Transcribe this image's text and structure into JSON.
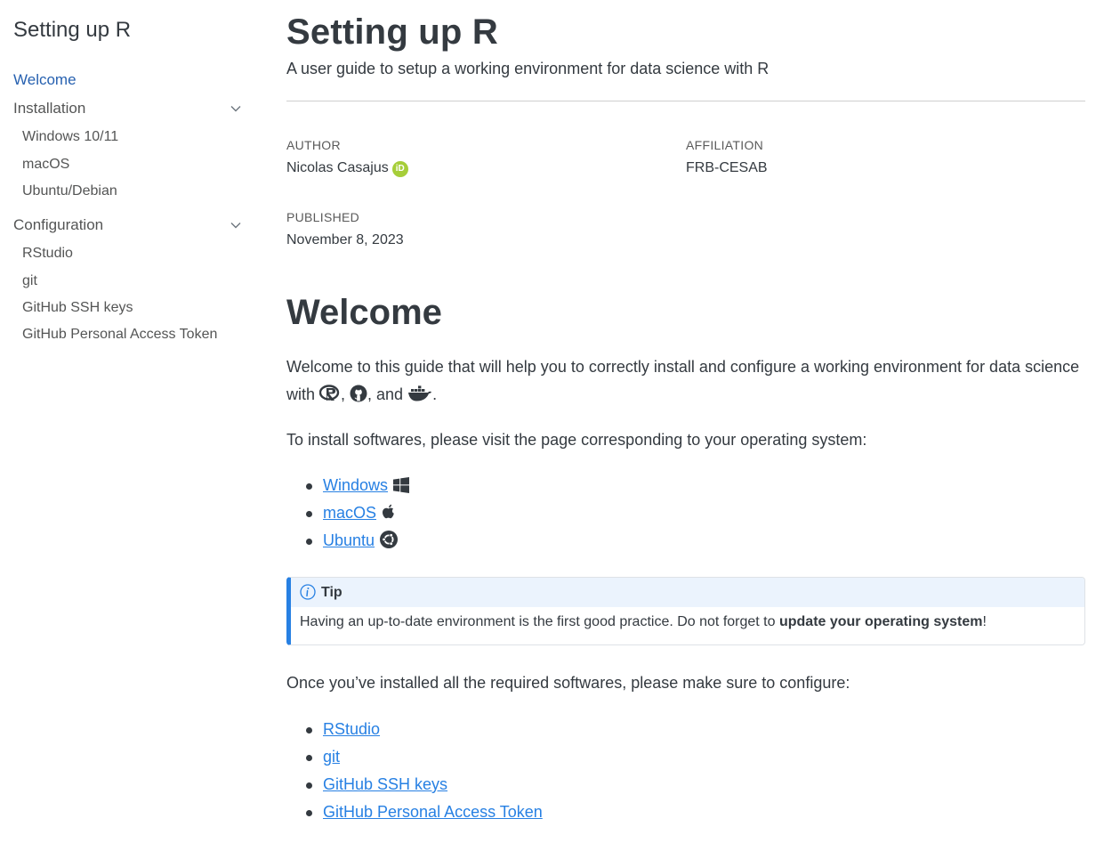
{
  "sidebar": {
    "title": "Setting up R",
    "welcome": "Welcome",
    "installation": {
      "label": "Installation",
      "items": [
        "Windows 10/11",
        "macOS",
        "Ubuntu/Debian"
      ]
    },
    "configuration": {
      "label": "Configuration",
      "items": [
        "RStudio",
        "git",
        "GitHub SSH keys",
        "GitHub Personal Access Token"
      ]
    }
  },
  "main": {
    "title": "Setting up R",
    "subtitle": "A user guide to setup a working environment for data science with R",
    "meta": {
      "author_label": "AUTHOR",
      "author": "Nicolas Casajus",
      "affiliation_label": "AFFILIATION",
      "affiliation": "FRB-CESAB",
      "published_label": "PUBLISHED",
      "published": "November 8, 2023"
    },
    "section_title": "Welcome",
    "intro": {
      "text_a": "Welcome to this guide that will help you to correctly install and configure a working environment for data science with ",
      "sep1": ", ",
      "sep2": ", and ",
      "end": "."
    },
    "install_text": "To install softwares, please visit the page corresponding to your operating system:",
    "os_links": [
      {
        "label": "Windows",
        "icon": "windows-icon"
      },
      {
        "label": "macOS",
        "icon": "apple-icon"
      },
      {
        "label": "Ubuntu",
        "icon": "ubuntu-icon"
      }
    ],
    "callout": {
      "title": "Tip",
      "body_a": "Having an up-to-date environment is the first good practice. Do not forget to ",
      "body_bold": "update your operating system",
      "body_end": "!"
    },
    "configure_text": "Once you’ve installed all the required softwares, please make sure to configure:",
    "config_links": [
      "RStudio",
      "git",
      "GitHub SSH keys",
      "GitHub Personal Access Token"
    ]
  },
  "colors": {
    "link": "#2780e3",
    "active_nav": "#2761b0",
    "callout_accent": "#2780e3",
    "callout_header_bg": "#ebf3fd",
    "orcid": "#a6ce39"
  }
}
